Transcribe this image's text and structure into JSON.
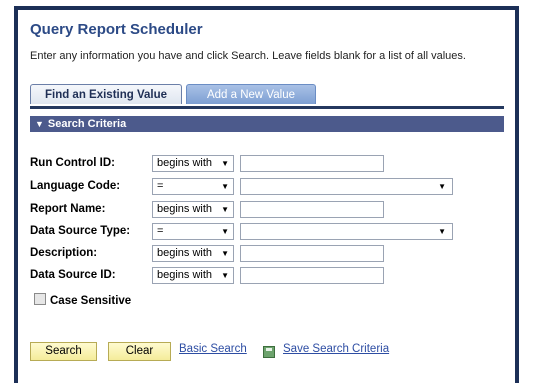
{
  "page": {
    "title": "Query Report Scheduler",
    "instructions": "Enter any information you have and click Search. Leave fields blank for a list of all values."
  },
  "tabs": [
    {
      "label": "Find an Existing Value",
      "active": true
    },
    {
      "label": "Add a New Value",
      "active": false
    }
  ],
  "section": {
    "label": "Search Criteria",
    "icon": "triangle-down-icon"
  },
  "fields": [
    {
      "label": "Run Control ID:",
      "operator": "begins with",
      "value": "",
      "input": "text"
    },
    {
      "label": "Language Code:",
      "operator": "=",
      "value": "",
      "input": "select"
    },
    {
      "label": "Report Name:",
      "operator": "begins with",
      "value": "",
      "input": "text"
    },
    {
      "label": "Data Source Type:",
      "operator": "=",
      "value": "",
      "input": "select"
    },
    {
      "label": "Description:",
      "operator": "begins with",
      "value": "",
      "input": "text"
    },
    {
      "label": "Data Source ID:",
      "operator": "begins with",
      "value": "",
      "input": "text"
    }
  ],
  "case_sensitive": {
    "label": "Case Sensitive",
    "checked": false
  },
  "buttons": {
    "search": "Search",
    "clear": "Clear"
  },
  "links": {
    "basic_search": "Basic Search",
    "save_search": "Save Search Criteria"
  },
  "glyphs": {
    "dropdown": "▼",
    "section_toggle": "▼"
  },
  "colors": {
    "title": "#2c4a86",
    "section_bar": "#4c5a8c",
    "button_bg": "#f4ec9a",
    "link": "#2d4da3",
    "frame": "#1c2f57"
  }
}
